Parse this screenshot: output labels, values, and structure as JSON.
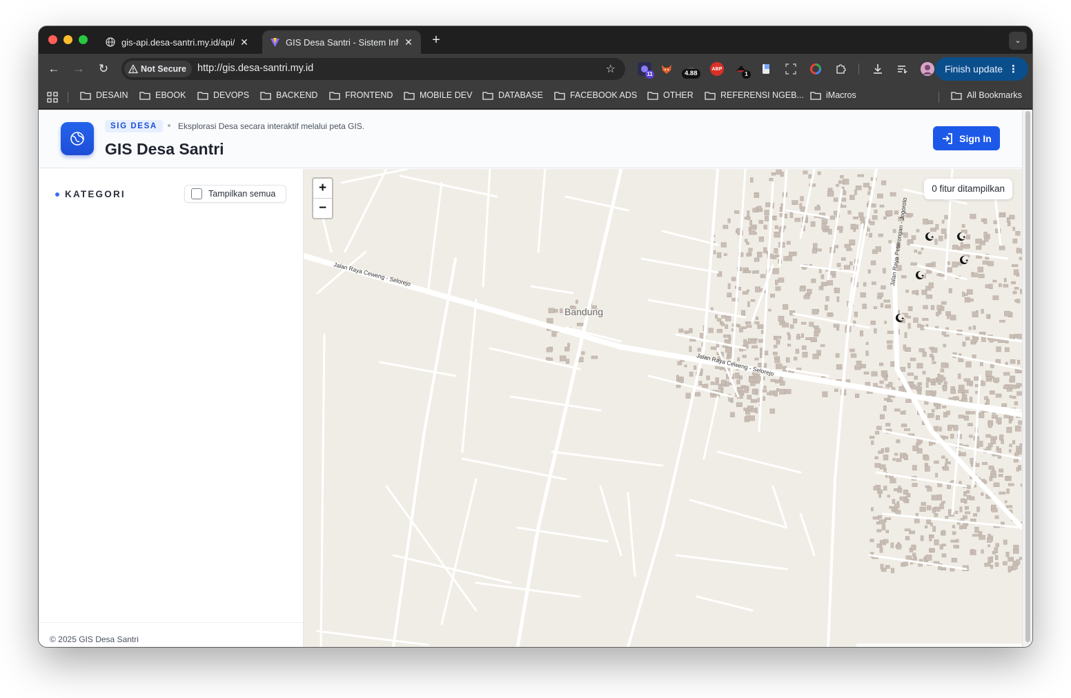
{
  "browser": {
    "tabs": [
      {
        "title": "gis-api.desa-santri.my.id/api/",
        "close": "✕"
      },
      {
        "title": "GIS Desa Santri - Sistem Infor",
        "close": "✕"
      }
    ],
    "new_tab": "+",
    "security_label": "Not Secure",
    "url": "http://gis.desa-santri.my.id",
    "extensions": [
      {
        "name": "extension-11-icon",
        "badge": "11"
      },
      {
        "name": "extension-fox-icon"
      },
      {
        "name": "extension-score-icon",
        "badge": "4.88"
      },
      {
        "name": "adblock-icon",
        "text": "ABP"
      },
      {
        "name": "extension-hat-icon",
        "badge": "1"
      },
      {
        "name": "extension-doc-icon"
      },
      {
        "name": "screenshot-icon"
      },
      {
        "name": "color-picker-icon"
      },
      {
        "name": "extensions-puzzle-icon"
      },
      {
        "name": "download-icon"
      },
      {
        "name": "reading-list-icon"
      },
      {
        "name": "profile-avatar-icon"
      }
    ],
    "finish_update": "Finish update",
    "bookmarks": [
      "DESAIN",
      "EBOOK",
      "DEVOPS",
      "BACKEND",
      "FRONTEND",
      "MOBILE DEV",
      "DATABASE",
      "FACEBOOK ADS",
      "OTHER",
      "REFERENSI NGEB...",
      "iMacros"
    ],
    "all_bookmarks": "All Bookmarks"
  },
  "header": {
    "pill": "SIG DESA",
    "tagline": "Eksplorasi Desa secara interaktif melalui peta GIS.",
    "title": "GIS Desa Santri",
    "sign_in": "Sign In"
  },
  "sidebar": {
    "section_label": "KATEGORI",
    "show_all_label": "Tampilkan semua",
    "show_all_checked": false,
    "footer": "© 2025 GIS Desa Santri"
  },
  "map": {
    "zoom_in": "+",
    "zoom_out": "−",
    "feature_count": "0 fitur ditampilkan",
    "place_label": "Bandung",
    "road_label_1": "Jalan Raya Ceweng - Selorejo",
    "road_label_2": "Jalan Raya Ceweng - Selorejo",
    "road_label_3": "Jalan Raya Peterongan - Jogoroto",
    "mosque_marker_count": 5
  },
  "colors": {
    "accent": "#1d59e8",
    "map_background": "#f0ede6",
    "road": "#ffffff",
    "building": "#c9beb5",
    "browser_chrome": "#3c3c3c",
    "finish_update": "#0b4e8c"
  }
}
